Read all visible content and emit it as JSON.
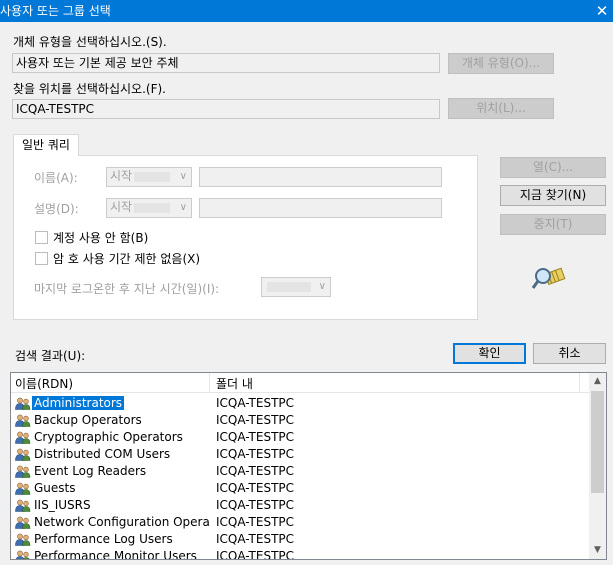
{
  "window": {
    "title": "사용자 또는 그룹 선택",
    "close_glyph": "✕"
  },
  "object_type": {
    "label": "개체 유형을 선택하십시오.(S).",
    "value": "사용자 또는 기본 제공 보안 주체",
    "button": "개체 유형(O)..."
  },
  "location": {
    "label": "찾을 위치를 선택하십시오.(F).",
    "value": "ICQA-TESTPC",
    "button": "위치(L)..."
  },
  "query": {
    "tab": "일반 쿼리",
    "name_label": "이름(A):",
    "name_op": "시작",
    "desc_label": "설명(D):",
    "desc_op": "시작",
    "disabled_accounts": "계정 사용 안 함(B)",
    "non_expiring": "암 호 사용 기간 제한 없음(X)",
    "days_since_logon": "마지막 로그온한 후 지난 시간(일)(I):"
  },
  "side_buttons": {
    "columns": "열(C)...",
    "find_now": "지금 찾기(N)",
    "stop": "중지(T)"
  },
  "search_results_label": "검색 결과(U):",
  "ok_button": "확인",
  "cancel_button": "취소",
  "results": {
    "columns": [
      "이름(RDN)",
      "폴더 내"
    ],
    "rows": [
      {
        "name": "Administrators",
        "folder": "ICQA-TESTPC"
      },
      {
        "name": "Backup Operators",
        "folder": "ICQA-TESTPC"
      },
      {
        "name": "Cryptographic Operators",
        "folder": "ICQA-TESTPC"
      },
      {
        "name": "Distributed COM Users",
        "folder": "ICQA-TESTPC"
      },
      {
        "name": "Event Log Readers",
        "folder": "ICQA-TESTPC"
      },
      {
        "name": "Guests",
        "folder": "ICQA-TESTPC"
      },
      {
        "name": "IIS_IUSRS",
        "folder": "ICQA-TESTPC"
      },
      {
        "name": "Network Configuration Opera...",
        "folder": "ICQA-TESTPC"
      },
      {
        "name": "Performance Log Users",
        "folder": "ICQA-TESTPC"
      },
      {
        "name": "Performance Monitor Users",
        "folder": "ICQA-TESTPC"
      }
    ]
  },
  "colors": {
    "titlebar": "#0078d7",
    "selection": "#0078d7"
  }
}
